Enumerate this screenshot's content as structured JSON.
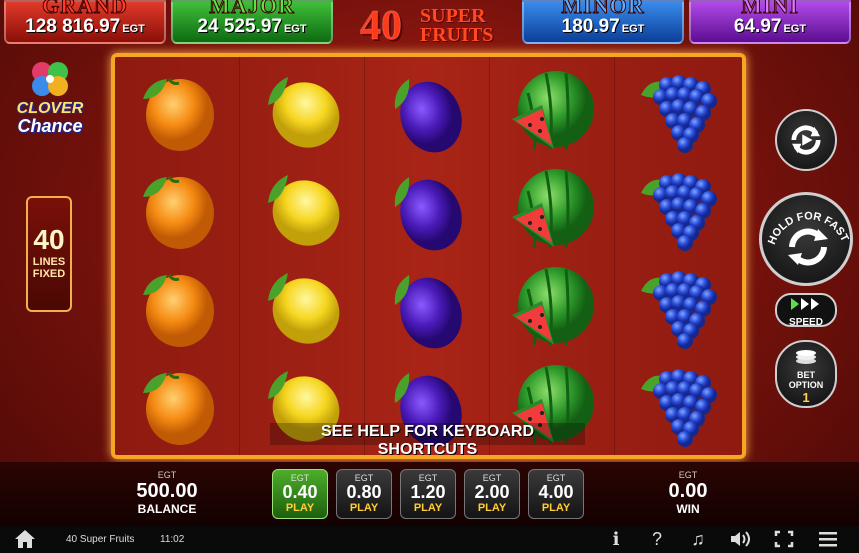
{
  "jackpots": {
    "grand": {
      "title": "GRAND",
      "value": "128 816.97",
      "unit": "EGT"
    },
    "major": {
      "title": "MAJOR",
      "value": "24 525.97",
      "unit": "EGT"
    },
    "minor": {
      "title": "MINOR",
      "value": "180.97",
      "unit": "EGT"
    },
    "mini": {
      "title": "MINI",
      "value": "64.97",
      "unit": "EGT"
    }
  },
  "game_logo": {
    "number": "40",
    "line1": "SUPER",
    "line2": "FRUITS"
  },
  "clover_logo": {
    "line1": "CLOVER",
    "line2": "Chance"
  },
  "lines_badge": {
    "number": "40",
    "line1": "LINES",
    "line2": "FIXED"
  },
  "reels": [
    [
      "orange",
      "orange",
      "orange",
      "orange"
    ],
    [
      "lemon",
      "lemon",
      "lemon",
      "lemon"
    ],
    [
      "plum",
      "plum",
      "plum",
      "plum"
    ],
    [
      "watermelon",
      "watermelon",
      "watermelon",
      "watermelon"
    ],
    [
      "grapes",
      "grapes",
      "grapes",
      "grapes"
    ]
  ],
  "help_text": "SEE HELP FOR KEYBOARD SHORTCUTS",
  "controls": {
    "hold_text": "HOLD FOR FAST PLAY",
    "speed_label": "SPEED",
    "bet_option_label_1": "BET",
    "bet_option_label_2": "OPTION",
    "bet_option_value": "1"
  },
  "balance": {
    "unit": "EGT",
    "value": "500.00",
    "label": "BALANCE"
  },
  "win": {
    "unit": "EGT",
    "value": "0.00",
    "label": "WIN"
  },
  "bets": [
    {
      "unit": "EGT",
      "value": "0.40",
      "label": "PLAY",
      "active": true
    },
    {
      "unit": "EGT",
      "value": "0.80",
      "label": "PLAY",
      "active": false
    },
    {
      "unit": "EGT",
      "value": "1.20",
      "label": "PLAY",
      "active": false
    },
    {
      "unit": "EGT",
      "value": "2.00",
      "label": "PLAY",
      "active": false
    },
    {
      "unit": "EGT",
      "value": "4.00",
      "label": "PLAY",
      "active": false
    }
  ],
  "system_bar": {
    "game_name": "40 Super Fruits",
    "clock": "11:02",
    "icons": [
      "info-icon",
      "help-icon",
      "music-icon",
      "volume-icon",
      "fullscreen-icon",
      "menu-icon"
    ]
  },
  "colors": {
    "frame": "#f5a623",
    "grand": "#e03a2a",
    "major": "#3fbf3a",
    "minor": "#3a8bea",
    "mini": "#b24ae8",
    "active_bet": "#4cae2a"
  }
}
